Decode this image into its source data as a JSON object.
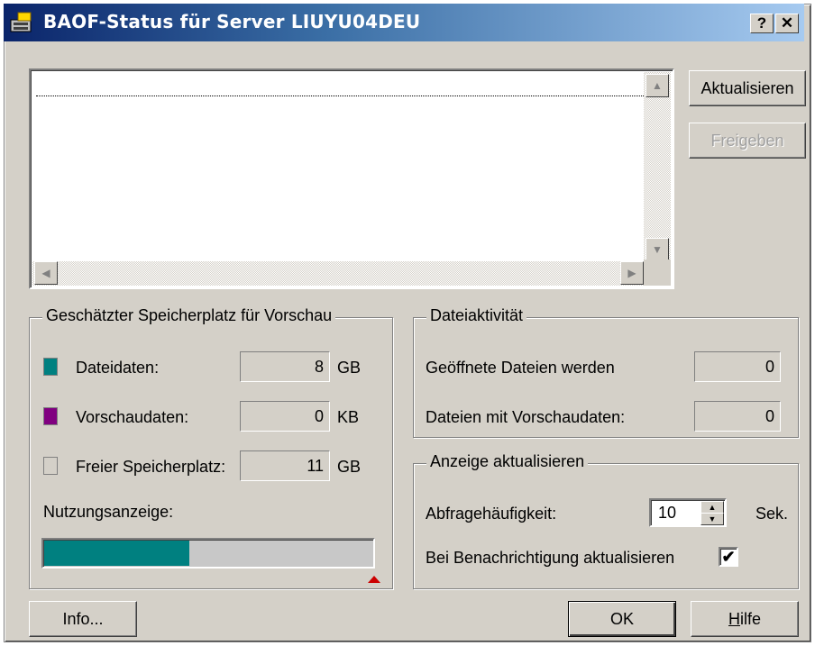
{
  "window": {
    "title": "BAOF-Status für Server LIUYU04DEU",
    "help_button": "?",
    "close_button": "✕"
  },
  "buttons": {
    "refresh": "Aktualisieren",
    "release": "Freigeben",
    "info": "Info...",
    "ok": "OK",
    "help": "Hilfe",
    "help_mnemonic": "H",
    "help_rest": "ilfe"
  },
  "storage": {
    "title": "Geschätzter Speicherplatz für Vorschau",
    "rows": [
      {
        "label": "Dateidaten:",
        "value": "8",
        "unit": "GB",
        "color": "#008080"
      },
      {
        "label": "Vorschaudaten:",
        "value": "0",
        "unit": "KB",
        "color": "#800080"
      },
      {
        "label": "Freier Speicherplatz:",
        "value": "11",
        "unit": "GB",
        "color": "#d4d0c8"
      }
    ],
    "usage_label": "Nutzungsanzeige:",
    "usage_fraction": 0.44
  },
  "activity": {
    "title": "Dateiaktivität",
    "rows": [
      {
        "label": "Geöffnete Dateien werden",
        "value": "0"
      },
      {
        "label": "Dateien mit Vorschaudaten:",
        "value": "0"
      }
    ]
  },
  "refresh_display": {
    "title": "Anzeige aktualisieren",
    "interval_label": "Abfragehäufigkeit:",
    "interval_value": "10",
    "interval_unit": "Sek.",
    "notify_label": "Bei Benachrichtigung aktualisieren",
    "notify_checked": true
  }
}
